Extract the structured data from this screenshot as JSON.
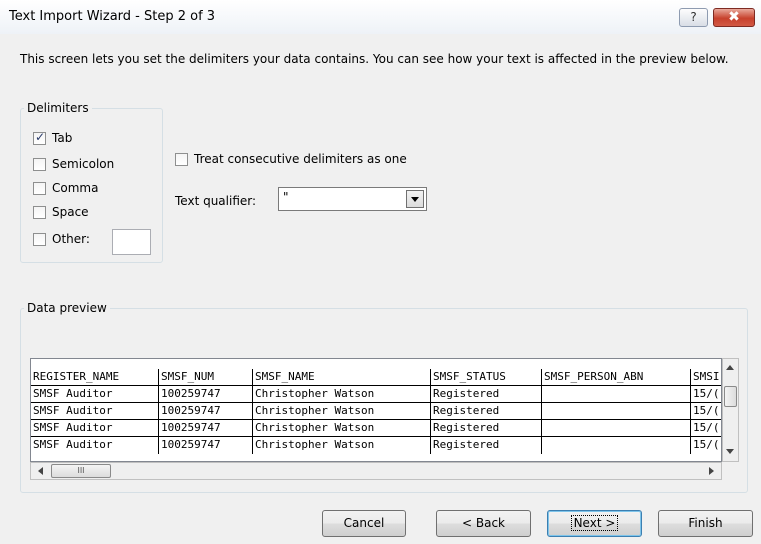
{
  "window": {
    "title": "Text Import Wizard - Step 2 of 3",
    "help_glyph": "?",
    "close_glyph": "✖"
  },
  "intro": "This screen lets you set the delimiters your data contains.  You can see how your text is affected in the preview below.",
  "delimiters": {
    "group_label": "Delimiters",
    "tab": {
      "label": "Tab",
      "checked": true
    },
    "semicolon": {
      "label": "Semicolon",
      "checked": false
    },
    "comma": {
      "label": "Comma",
      "checked": false
    },
    "space": {
      "label": "Space",
      "checked": false
    },
    "other": {
      "label": "Other:",
      "checked": false,
      "value": ""
    }
  },
  "consecutive": {
    "label": "Treat consecutive delimiters as one",
    "checked": false
  },
  "qualifier": {
    "label": "Text qualifier:",
    "value": "\""
  },
  "preview": {
    "group_label": "Data preview",
    "headers": [
      "REGISTER_NAME",
      "SMSF_NUM",
      "SMSF_NAME",
      "SMSF_STATUS",
      "SMSF_PERSON_ABN",
      "SMSI"
    ],
    "rows": [
      [
        "SMSF Auditor",
        "100259747",
        "Christopher Watson",
        "Registered",
        "",
        "15/("
      ],
      [
        "SMSF Auditor",
        "100259747",
        "Christopher Watson",
        "Registered",
        "",
        "15/("
      ],
      [
        "SMSF Auditor",
        "100259747",
        "Christopher Watson",
        "Registered",
        "",
        "15/("
      ],
      [
        "SMSF Auditor",
        "100259747",
        "Christopher Watson",
        "Registered",
        "",
        "15/("
      ]
    ],
    "hscroll_grip": "III"
  },
  "buttons": {
    "cancel": "Cancel",
    "back": "< Back",
    "next": "Next >",
    "finish": "Finish"
  }
}
